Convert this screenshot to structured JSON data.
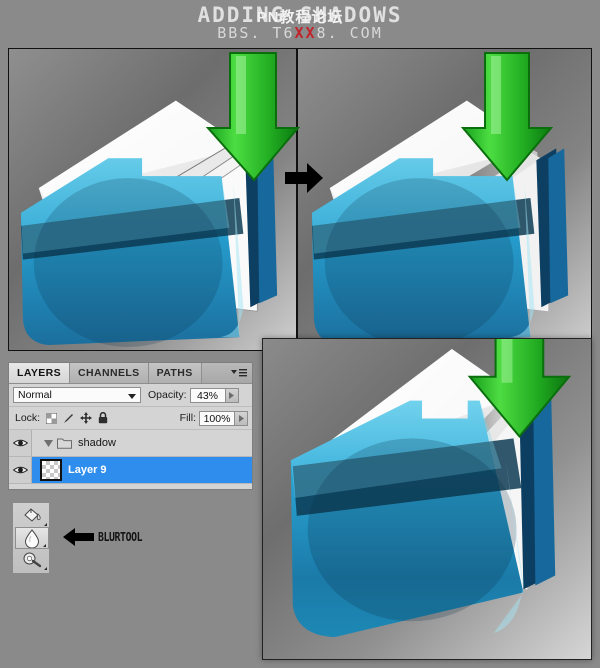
{
  "header": {
    "title": "ADDING SHADOWS",
    "title_overlay_cn": "PN教程论坛",
    "watermark_prefix": "BBS. T6",
    "watermark_highlight": "XX",
    "watermark_suffix": "8. COM"
  },
  "panels": {
    "before": {
      "name": "before-preview",
      "alt": "folder icon without shadow"
    },
    "after": {
      "name": "after-preview",
      "alt": "folder icon with shadow"
    },
    "result": {
      "name": "result-preview",
      "alt": "final folder icon large"
    },
    "step_arrow": "arrow-right"
  },
  "layers_panel": {
    "tabs": [
      {
        "label": "LAYERS",
        "active": true
      },
      {
        "label": "CHANNELS",
        "active": false
      },
      {
        "label": "PATHS",
        "active": false
      }
    ],
    "menu_icon": "panel-menu-icon",
    "blend_mode": "Normal",
    "blend_caret": "chevron-down-icon",
    "opacity_label": "Opacity:",
    "opacity_value": "43%",
    "lock_label": "Lock:",
    "lock_icons": [
      "transparency-lock-icon",
      "paint-lock-icon",
      "position-lock-icon",
      "all-lock-icon"
    ],
    "fill_label": "Fill:",
    "fill_value": "100%",
    "layers": [
      {
        "name": "shadow",
        "type": "group",
        "visible": true,
        "selected": false,
        "expanded": true,
        "icons": [
          "eye-icon",
          "disclosure-triangle-icon",
          "folder-icon"
        ]
      },
      {
        "name": "Layer 9",
        "type": "layer",
        "visible": true,
        "selected": true,
        "icons": [
          "eye-icon",
          "layer-thumbnail"
        ]
      }
    ]
  },
  "toolbox": {
    "tools": [
      {
        "name": "paint-bucket-tool",
        "active": false
      },
      {
        "name": "blur-tool",
        "active": true
      },
      {
        "name": "dodge-tool",
        "active": false
      }
    ],
    "callout_arrow": "arrow-left",
    "callout_label": "BLURTOOL"
  },
  "colors": {
    "page_background": "#8a8a8a",
    "panel_border": "#111111",
    "folder_cyan": "#2fa9d8",
    "folder_light_cyan": "#7fd4ea",
    "folder_dark_band": "#0d3a52",
    "folder_deep_blue": "#0f4f77",
    "arrow_green": "#2bbf26",
    "arrow_green_dark": "#0e8413",
    "paper_white": "#f1f1f1",
    "selection_blue": "#2f8ded",
    "watermark_red": "#c3232b"
  }
}
